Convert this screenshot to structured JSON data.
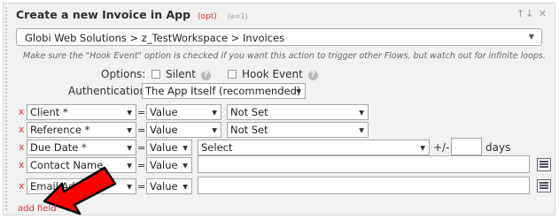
{
  "step": {
    "title": "Create a new Invoice in App",
    "opt": "(opt)",
    "action_id": "(a=1)",
    "controls": {
      "move_up": "↑",
      "move_down": "↓",
      "close": "✕"
    }
  },
  "account": {
    "path": "Globi Web Solutions > z_TestWorkspace > Invoices"
  },
  "note": "Make sure the \"Hook Event\" option is checked if you want this action to trigger other Flows, but watch out for infinite loops.",
  "options": {
    "label": "Options:",
    "silent": "Silent",
    "hook_event": "Hook Event",
    "help": "?"
  },
  "authentication": {
    "label": "Authentication:",
    "value": "The App Itself (recommended)"
  },
  "rows": [
    {
      "remove": "x",
      "field": "Client *",
      "eq": "=",
      "mode": "Value",
      "value": "Not Set"
    },
    {
      "remove": "x",
      "field": "Reference *",
      "eq": "=",
      "mode": "Value",
      "value": "Not Set"
    },
    {
      "remove": "x",
      "field": "Due Date *",
      "eq": "=",
      "mode": "Value",
      "value": "Select",
      "offset_label": "+/-",
      "unit": "days"
    },
    {
      "remove": "x",
      "field": "Contact Name",
      "eq": "=",
      "mode": "Value",
      "value": ""
    },
    {
      "remove": "x",
      "field": "Email Address",
      "eq": "=",
      "mode": "Value",
      "value": ""
    }
  ],
  "add_field": "add field",
  "colors": {
    "accent_red": "#dd3333",
    "arrow_red": "#ff0000",
    "panel_bg": "#f1f1f1"
  },
  "icons": [
    "chevron-down-icon",
    "help-icon",
    "text-picker-icon",
    "red-pointer-arrow"
  ]
}
